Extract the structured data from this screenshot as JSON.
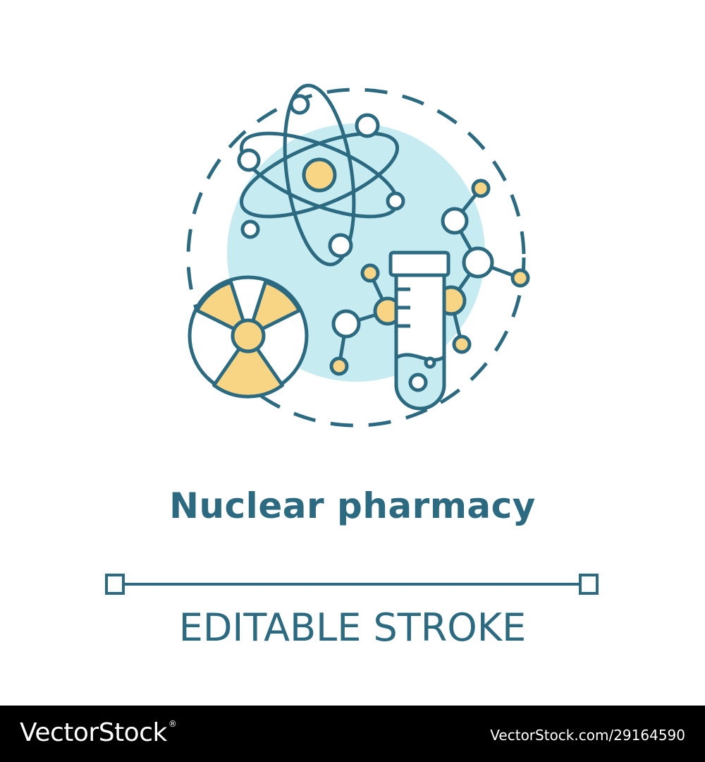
{
  "title": "Nuclear pharmacy",
  "subtitle": "EDITABLE STROKE",
  "footer": {
    "logo": "VectorStock",
    "logo_mark": "®",
    "image_id": "VectorStock.com/29164590"
  },
  "colors": {
    "stroke": "#2b6a80",
    "accent_yellow": "#f8d585",
    "background_circle": "#c6ecf1",
    "text": "#2b6a80",
    "footer_bg": "#000000"
  },
  "icons": [
    "atom-icon",
    "radiation-icon",
    "molecule-icon",
    "test-tube-icon"
  ]
}
